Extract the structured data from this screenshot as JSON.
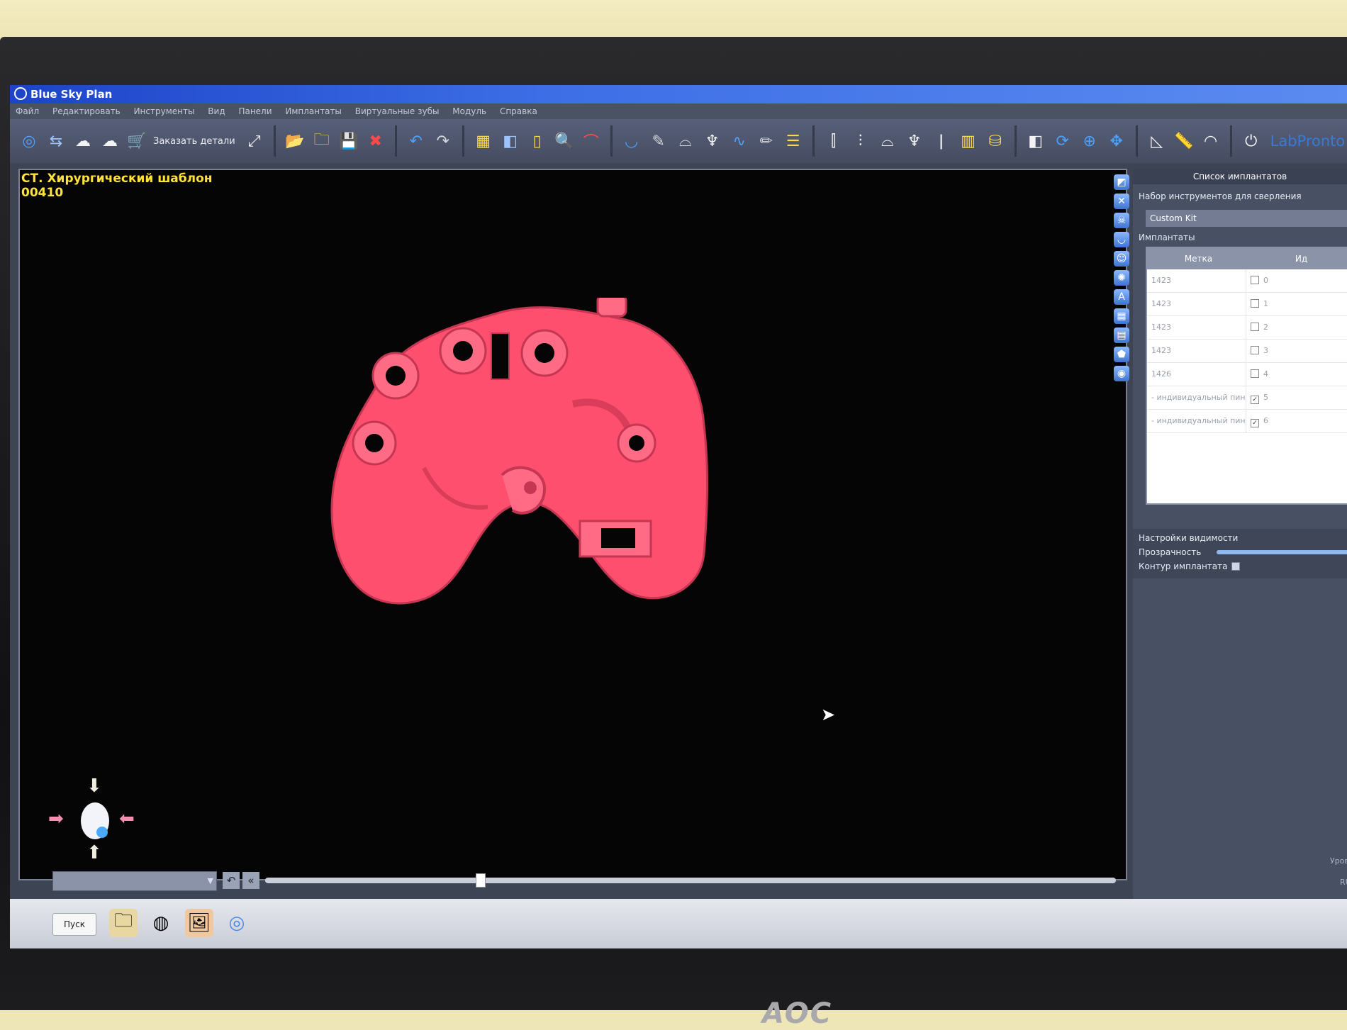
{
  "window": {
    "title": "Blue Sky Plan"
  },
  "menu": [
    "Файл",
    "Редактировать",
    "Инструменты",
    "Вид",
    "Панели",
    "Имплантаты",
    "Виртуальные зубы",
    "Модуль",
    "Справка"
  ],
  "toolbar": {
    "order_label": "Заказать детали",
    "brand_label": "LabPronto"
  },
  "viewport": {
    "line1": "СТ. Хирургический шаблон",
    "line2": "00410",
    "model_color": "#ff4f6e"
  },
  "panel": {
    "title": "Список имплантатов",
    "kit_section": "Набор инструментов для сверления",
    "kit_value": "Custom Kit",
    "implants_section": "Имплантаты",
    "columns": [
      "Метка",
      "Ид"
    ],
    "rows": [
      {
        "label": "1423",
        "id": "0",
        "checked": false
      },
      {
        "label": "1423",
        "id": "1",
        "checked": false
      },
      {
        "label": "1423",
        "id": "2",
        "checked": false
      },
      {
        "label": "1423",
        "id": "3",
        "checked": false
      },
      {
        "label": "1426",
        "id": "4",
        "checked": false
      },
      {
        "label": "- индивидуальный пин -",
        "id": "5",
        "checked": true
      },
      {
        "label": "- индивидуальный пин -",
        "id": "6",
        "checked": true
      }
    ],
    "visibility_section": "Настройки видимости",
    "transparency_label": "Прозрачность",
    "contour_label": "Контур имплантата",
    "level_label": "Уровен",
    "lang_label": "RU"
  },
  "taskbar": {
    "start_label": "Пуск"
  },
  "monitor_brand": "AOC",
  "timeline": {
    "position": 0.25
  }
}
